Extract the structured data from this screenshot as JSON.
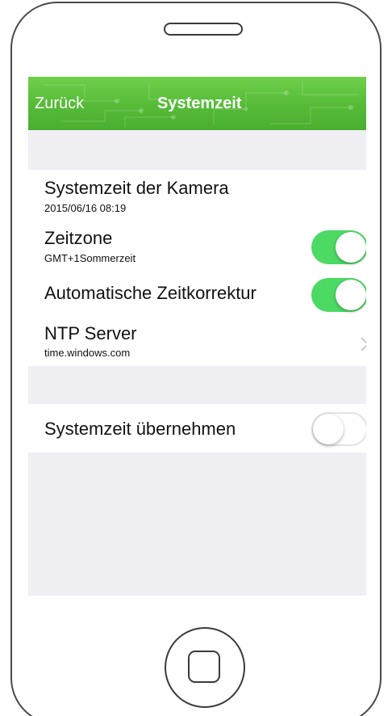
{
  "navbar": {
    "back_label": "Zurück",
    "title": "Systemzeit",
    "accent_color": "#55bb37"
  },
  "settings": {
    "camera_time": {
      "label": "Systemzeit der Kamera",
      "value": "2015/06/16 08:19"
    },
    "timezone": {
      "label": "Zeitzone",
      "value": "GMT+1Sommerzeit",
      "enabled": true
    },
    "auto_correction": {
      "label": "Automatische Zeitkorrektur",
      "enabled": true
    },
    "ntp_server": {
      "label": "NTP Server",
      "value": "time.windows.com"
    },
    "adopt_time": {
      "label": "Systemzeit übernehmen",
      "enabled": false
    }
  },
  "colors": {
    "toggle_on": "#4cd964",
    "background": "#efeff4"
  }
}
